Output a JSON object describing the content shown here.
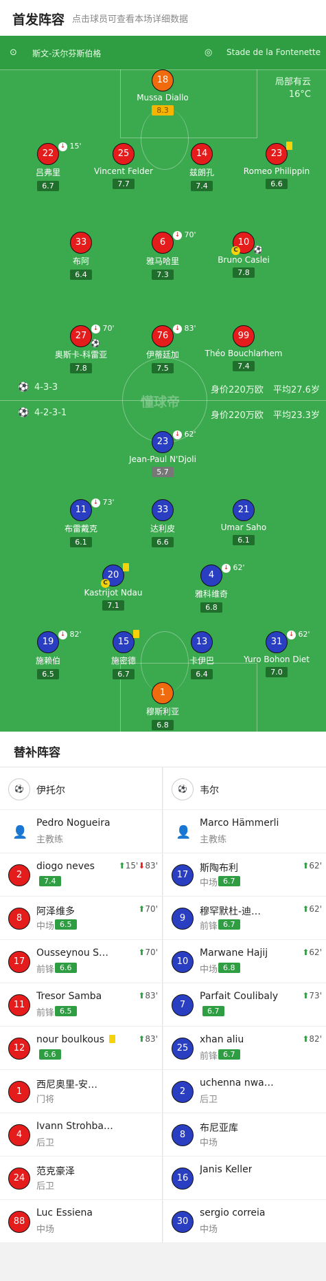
{
  "header": {
    "title": "首发阵容",
    "subtitle": "点击球员可查看本场详细数据"
  },
  "venue": {
    "home_team": "斯文-沃尔芬斯伯格",
    "stadium": "Stade de la Fontenette"
  },
  "weather": {
    "condition": "局部有云",
    "temperature": "16°C"
  },
  "watermark": "懂球帝",
  "formations": {
    "top": {
      "shape": "4-3-3",
      "value": "身价220万欧",
      "avg_age": "平均27.6岁"
    },
    "bottom": {
      "shape": "4-2-3-1",
      "value": "身价220万欧",
      "avg_age": "平均23.3岁"
    }
  },
  "starters": [
    {
      "num": "18",
      "name": "Mussa Diallo",
      "rating": "8.3",
      "color": "orange",
      "best": true
    },
    {
      "num": "22",
      "name": "吕弗里",
      "rating": "6.7",
      "color": "red",
      "sub": "15'"
    },
    {
      "num": "25",
      "name": "Vincent Felder",
      "rating": "7.7",
      "color": "red"
    },
    {
      "num": "14",
      "name": "兹朗孔",
      "rating": "7.4",
      "color": "red"
    },
    {
      "num": "23",
      "name": "Romeo Philippin",
      "rating": "6.6",
      "color": "red",
      "yellow": true
    },
    {
      "num": "33",
      "name": "布阿",
      "rating": "6.4",
      "color": "red"
    },
    {
      "num": "6",
      "name": "雅马哈里",
      "rating": "7.3",
      "color": "red",
      "sub": "70'"
    },
    {
      "num": "10",
      "name": "Bruno Caslei",
      "rating": "7.8",
      "color": "red",
      "captain": true,
      "goal": true
    },
    {
      "num": "27",
      "name": "奥斯卡-科雷亚",
      "rating": "7.8",
      "color": "red",
      "sub": "70'",
      "goal": true
    },
    {
      "num": "76",
      "name": "伊蒂廷加",
      "rating": "7.5",
      "color": "red",
      "sub": "83'"
    },
    {
      "num": "99",
      "name": "Théo Bouchlarhem",
      "rating": "7.4",
      "color": "red"
    },
    {
      "num": "23",
      "name": "Jean-Paul N'Djoli",
      "rating": "5.7",
      "color": "blue",
      "sub": "62'",
      "gray": true
    },
    {
      "num": "11",
      "name": "布雷戴克",
      "rating": "6.1",
      "color": "blue",
      "sub": "73'"
    },
    {
      "num": "33",
      "name": "达利皮",
      "rating": "6.6",
      "color": "blue"
    },
    {
      "num": "21",
      "name": "Umar Saho",
      "rating": "6.1",
      "color": "blue"
    },
    {
      "num": "20",
      "name": "Kastrijot Ndau",
      "rating": "7.1",
      "color": "blue",
      "yellow": true,
      "captain": true
    },
    {
      "num": "4",
      "name": "雅科维奇",
      "rating": "6.8",
      "color": "blue",
      "sub": "62'"
    },
    {
      "num": "19",
      "name": "施赖伯",
      "rating": "6.5",
      "color": "blue",
      "sub": "82'"
    },
    {
      "num": "15",
      "name": "施密德",
      "rating": "6.7",
      "color": "blue",
      "yellow": true
    },
    {
      "num": "13",
      "name": "卡伊巴",
      "rating": "6.4",
      "color": "blue"
    },
    {
      "num": "31",
      "name": "Yuro Bohon Diet",
      "rating": "7.0",
      "color": "blue",
      "sub": "62'"
    },
    {
      "num": "1",
      "name": "穆斯利亚",
      "rating": "6.8",
      "color": "orange"
    }
  ],
  "bench": {
    "title": "替补阵容",
    "captain_mark": "C",
    "left": {
      "team": "伊托尔",
      "coach": {
        "name": "Pedro Nogueira",
        "role": "主教练"
      },
      "players": [
        {
          "num": "2",
          "name": "diogo neves",
          "pos": "",
          "rating": "7.4",
          "subs": [
            "15'",
            "83'"
          ]
        },
        {
          "num": "8",
          "name": "阿泽维多",
          "pos": "中场",
          "rating": "6.5",
          "subs": [
            "70'"
          ]
        },
        {
          "num": "17",
          "name": "Ousseynou S…",
          "pos": "前锋",
          "rating": "6.6",
          "subs": [
            "70'"
          ]
        },
        {
          "num": "11",
          "name": "Tresor Samba",
          "pos": "前锋",
          "rating": "6.5",
          "subs": [
            "83'"
          ]
        },
        {
          "num": "12",
          "name": "nour boulkous",
          "pos": "",
          "rating": "6.6",
          "subs": [
            "83'"
          ],
          "yellow": true
        },
        {
          "num": "1",
          "name": "西尼奥里-安…",
          "pos": "门将",
          "rating": ""
        },
        {
          "num": "4",
          "name": "Ivann Strohba…",
          "pos": "后卫",
          "rating": ""
        },
        {
          "num": "24",
          "name": "范克豪泽",
          "pos": "后卫",
          "rating": ""
        },
        {
          "num": "88",
          "name": "Luc Essiena",
          "pos": "中场",
          "rating": ""
        }
      ]
    },
    "right": {
      "team": "韦尔",
      "coach": {
        "name": "Marco Hämmerli",
        "role": "主教练"
      },
      "players": [
        {
          "num": "17",
          "name": "斯陶布利",
          "pos": "中场",
          "rating": "6.7",
          "subs": [
            "62'"
          ]
        },
        {
          "num": "9",
          "name": "穆罕默杜-迪…",
          "pos": "前锋",
          "rating": "6.7",
          "subs": [
            "62'"
          ]
        },
        {
          "num": "10",
          "name": "Marwane Hajij",
          "pos": "中场",
          "rating": "6.8",
          "subs": [
            "62'"
          ]
        },
        {
          "num": "7",
          "name": "Parfait Coulibaly",
          "pos": "",
          "rating": "6.7",
          "subs": [
            "73'"
          ]
        },
        {
          "num": "25",
          "name": "xhan aliu",
          "pos": "前锋",
          "rating": "6.7",
          "subs": [
            "82'"
          ]
        },
        {
          "num": "2",
          "name": "uchenna nwa…",
          "pos": "后卫",
          "rating": ""
        },
        {
          "num": "8",
          "name": "布尼亚库",
          "pos": "中场",
          "rating": ""
        },
        {
          "num": "16",
          "name": "Janis Keller",
          "pos": "",
          "rating": ""
        },
        {
          "num": "30",
          "name": "sergio correia",
          "pos": "中场",
          "rating": ""
        }
      ]
    }
  }
}
